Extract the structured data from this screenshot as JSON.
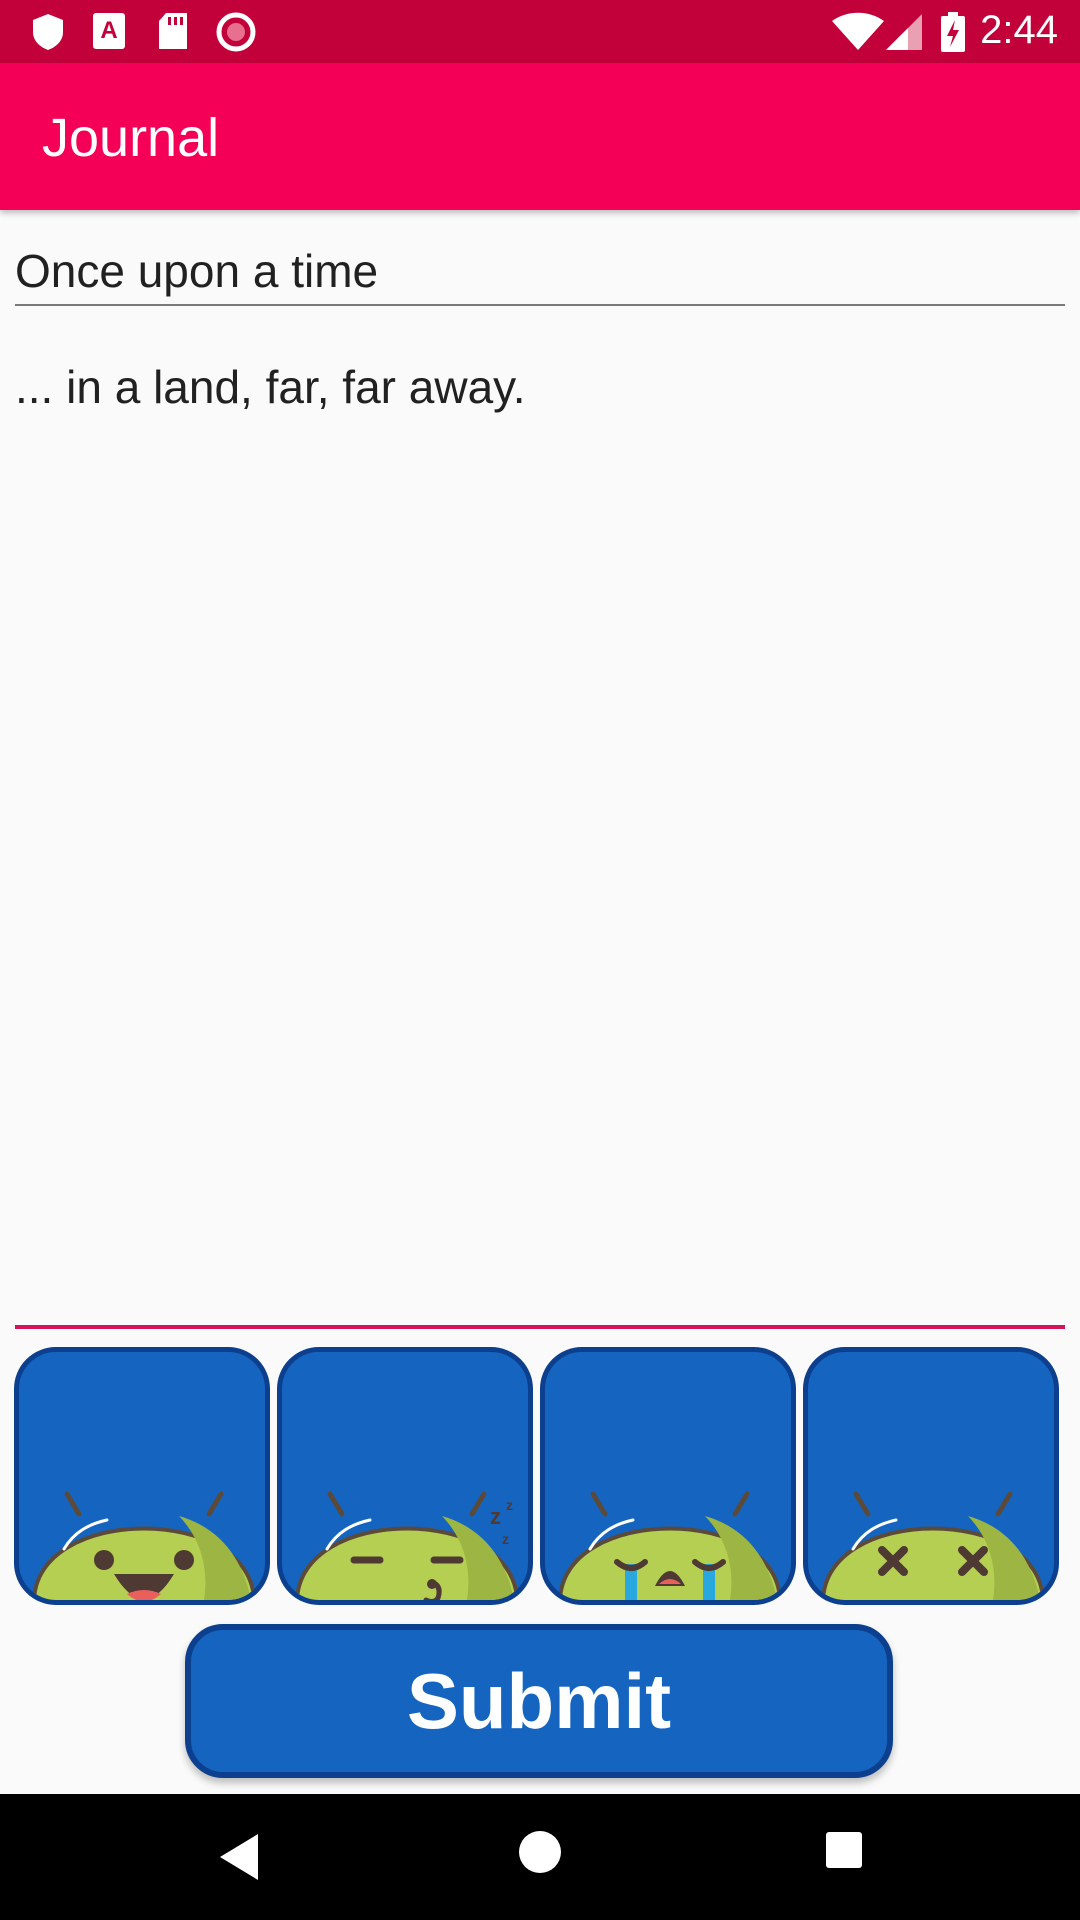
{
  "status_bar": {
    "time": "2:44",
    "left_icons": [
      "shield-icon",
      "a-icon",
      "sd-card-icon",
      "record-icon"
    ],
    "right_icons": [
      "wifi-icon",
      "signal-icon",
      "battery-charging-icon"
    ]
  },
  "app_bar": {
    "title": "Journal"
  },
  "entry": {
    "title_value": "Once upon a time",
    "body_value": "... in a land, far, far away."
  },
  "moods": [
    {
      "name": "happy",
      "icon": "happy-android-icon"
    },
    {
      "name": "sleepy",
      "icon": "sleepy-android-icon"
    },
    {
      "name": "sad",
      "icon": "crying-android-icon"
    },
    {
      "name": "dead",
      "icon": "dead-android-icon"
    }
  ],
  "submit_label": "Submit",
  "nav": {
    "buttons": [
      "back-icon",
      "home-icon",
      "recents-icon"
    ]
  },
  "colors": {
    "status_bar": "#c2003a",
    "app_bar": "#f50057",
    "button_fill": "#1565c0",
    "button_border": "#0d3f8f",
    "android_green": "#b5cf52"
  }
}
